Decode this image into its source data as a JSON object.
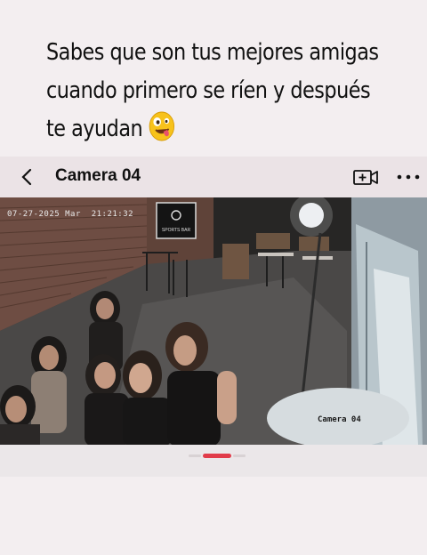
{
  "caption": {
    "line1": "Sabes que son tus mejores amigas",
    "line2": "cuando primero se ríen y después",
    "line3": "te ayudan",
    "emoji_icon": "zany-face-emoji"
  },
  "appbar": {
    "title": "Camera 04",
    "back_icon": "chevron-left-icon",
    "add_camera_icon": "video-add-icon",
    "more_icon": "more-horizontal-icon"
  },
  "video": {
    "timestamp": "07-27-2025 Mar  21:21:32",
    "camera_label": "Camera 04",
    "sign_text": "SPORTS BAR"
  },
  "colors": {
    "accent": "#e13c4a",
    "appbar_bg": "#ebe3e6",
    "page_bg": "#f3eef0"
  }
}
